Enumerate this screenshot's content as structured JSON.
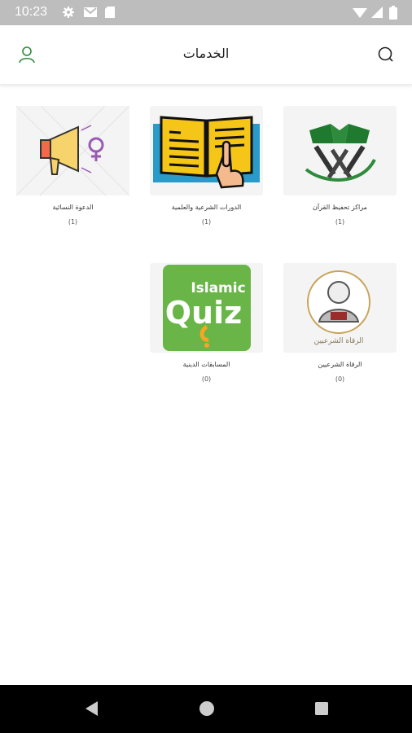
{
  "status_bar": {
    "time": "10:23"
  },
  "header": {
    "title": "الخدمات",
    "profile_icon": "user-icon",
    "search_icon": "search-icon"
  },
  "services": [
    {
      "label": "مراكز تحفيظ القرآن",
      "count": "(1)",
      "icon": "quran-stand-icon"
    },
    {
      "label": "الدورات الشرعية والعلمية",
      "count": "(1)",
      "icon": "open-book-icon"
    },
    {
      "label": "الدعوة النسائية",
      "count": "(1)",
      "icon": "megaphone-female-icon"
    },
    {
      "label": "الرقاة الشرعيين",
      "count": "(0)",
      "icon": "ruqya-sheikh-icon",
      "image_text": "الرقاة الشرعيين"
    },
    {
      "label": "المسابقات الدينية",
      "count": "(0)",
      "icon": "islamic-quiz-icon",
      "image_text_line1": "Islamic",
      "image_text_line2": "Quiz"
    }
  ],
  "colors": {
    "statusbar": "#bdbdbd",
    "accent_green": "#2e8b3c",
    "quiz_green": "#6ab547",
    "book_yellow": "#f5c518"
  }
}
